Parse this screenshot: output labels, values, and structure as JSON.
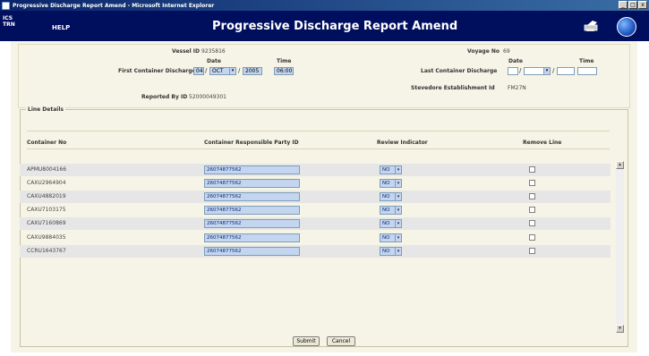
{
  "window": {
    "title": "Progressive Discharge Report Amend - Microsoft Internet Explorer",
    "min": "_",
    "max": "□",
    "close": "x"
  },
  "header": {
    "logo_line1": "ICS",
    "logo_line2": "TRN",
    "help": "HELP",
    "page_title": "Progressive Discharge Report Amend"
  },
  "form": {
    "vessel_id_label": "Vessel ID",
    "vessel_id": "9235816",
    "voyage_no_label": "Voyage No",
    "voyage_no": "69",
    "date_label": "Date",
    "time_label": "Time",
    "first_discharge_label": "First Container Discharge",
    "first_day": "04",
    "first_month": "OCT",
    "first_year": "2005",
    "first_time": "06:00",
    "last_discharge_label": "Last Container Discharge",
    "last_day": "",
    "last_month": "",
    "last_year": "",
    "last_time": "",
    "reported_by_label": "Reported By ID",
    "reported_by": "52000049301",
    "stevedore_label": "Stevedore Establishment Id",
    "stevedore": "FM27N"
  },
  "line_details": {
    "legend": "Line Details",
    "columns": [
      "Container No",
      "Container Responsible Party ID",
      "Review Indicator",
      "Remove Line"
    ],
    "rows": [
      {
        "container": "APMU8004166",
        "party": "26074877562",
        "review": "NO"
      },
      {
        "container": "CAXU2964904",
        "party": "26074877562",
        "review": "NO"
      },
      {
        "container": "CAXU4882019",
        "party": "26074877562",
        "review": "NO"
      },
      {
        "container": "CAXU7103175",
        "party": "26074877562",
        "review": "NO"
      },
      {
        "container": "CAXU7160869",
        "party": "26074877562",
        "review": "NO"
      },
      {
        "container": "CAXU9884035",
        "party": "26074877562",
        "review": "NO"
      },
      {
        "container": "CCRU1643767",
        "party": "26074877562",
        "review": "NO"
      }
    ]
  },
  "buttons": {
    "submit": "Submit",
    "cancel": "Cancel"
  },
  "icons": {
    "dropdown": "▾",
    "scroll_up": "▴",
    "scroll_down": "▾"
  }
}
